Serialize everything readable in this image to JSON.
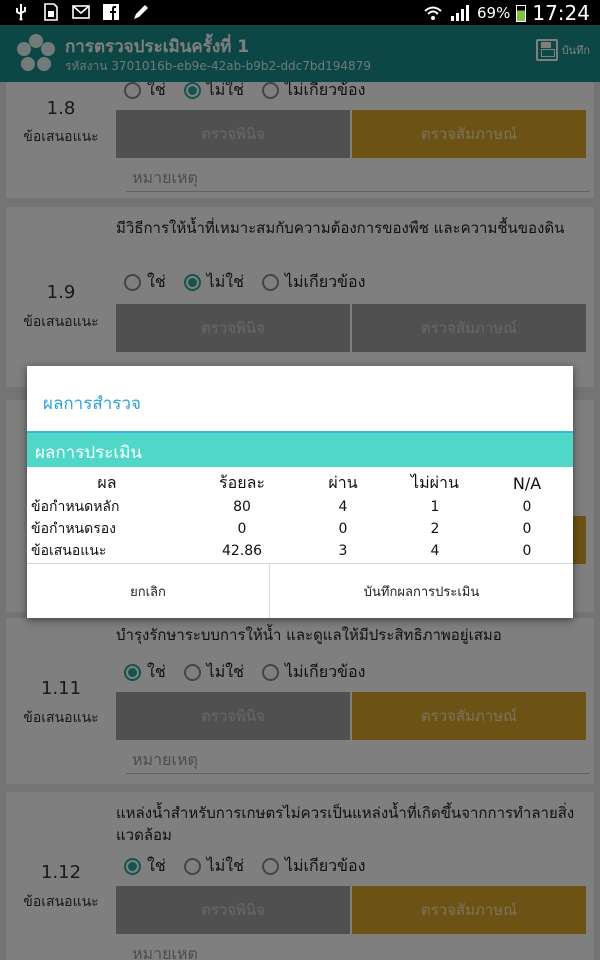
{
  "status_bar": {
    "time": "17:24",
    "battery": "69%",
    "icons": [
      "usb-icon",
      "sim-icon",
      "mail-icon",
      "facebook-icon",
      "pencil-icon",
      "wifi-icon",
      "signal-icon",
      "battery-icon"
    ]
  },
  "app_bar": {
    "title": "การตรวจประเมินครั้งที่ 1",
    "subtitle": "รหัสงาน 3701016b-eb9e-42ab-b9b2-ddc7bd194879",
    "save_label": "บันทึก"
  },
  "colors": {
    "app_bar": "#1a8f8a",
    "accent_gold": "#d9a72b",
    "radio_on": "#2aa79f",
    "dialog_title": "#2aa4d8",
    "dialog_band": "#4fd8c8"
  },
  "cards": {
    "c18": {
      "number": "1.8",
      "type": "ข้อเสนอแนะ",
      "opt_yes": "ใช่",
      "opt_no": "ไม่ใช่",
      "opt_na": "ไม่เกียวข้อง",
      "selected": "no",
      "btn_check": "ตรวจพินิจ",
      "btn_interview": "ตรวจสัมภาษณ์",
      "note_placeholder": "หมายเหตุ"
    },
    "c19": {
      "number": "1.9",
      "type": "ข้อเสนอแนะ",
      "question": "มีวิธีการให้น้ำที่เหมาะสมกับความต้องการของพืช และความชื้นของดิน",
      "opt_yes": "ใช่",
      "opt_no": "ไม่ใช่",
      "opt_na": "ไม่เกียวข้อง",
      "selected": "no",
      "btn_check": "ตรวจพินิจ",
      "btn_interview": "ตรวจสัมภาษณ์"
    },
    "c111": {
      "number": "1.11",
      "type": "ข้อเสนอแนะ",
      "question": "บำรุงรักษาระบบการให้น้ำ และดูแลให้มีประสิทธิภาพอยู่เสมอ",
      "opt_yes": "ใช่",
      "opt_no": "ไม่ใช่",
      "opt_na": "ไม่เกียวข้อง",
      "selected": "yes",
      "btn_check": "ตรวจพินิจ",
      "btn_interview": "ตรวจสัมภาษณ์",
      "note_placeholder": "หมายเหตุ"
    },
    "c112": {
      "number": "1.12",
      "type": "ข้อเสนอแนะ",
      "question": "แหล่งน้ำสำหรับการเกษตรไม่ควรเป็นแหล่งน้ำที่เกิดขึ้นจากการทำลายสิ่งแวดล้อม",
      "opt_yes": "ใช่",
      "opt_no": "ไม่ใช่",
      "opt_na": "ไม่เกียวข้อง",
      "selected": "yes",
      "btn_check": "ตรวจพินิจ",
      "btn_interview": "ตรวจสัมภาษณ์",
      "note_placeholder": "หมายเหตุ"
    }
  },
  "dialog": {
    "title": "ผลการสำรวจ",
    "section": "ผลการประเมิน",
    "headers": [
      "ผล",
      "ร้อยละ",
      "ผ่าน",
      "ไม่ผ่าน",
      "N/A"
    ],
    "rows": [
      [
        "ข้อกำหนดหลัก",
        "80",
        "4",
        "1",
        "0"
      ],
      [
        "ข้อกำหนดรอง",
        "0",
        "0",
        "2",
        "0"
      ],
      [
        "ข้อเสนอแนะ",
        "42.86",
        "3",
        "4",
        "0"
      ]
    ],
    "cancel_label": "ยกเลิก",
    "confirm_label": "บันทึกผลการประเมิน"
  }
}
